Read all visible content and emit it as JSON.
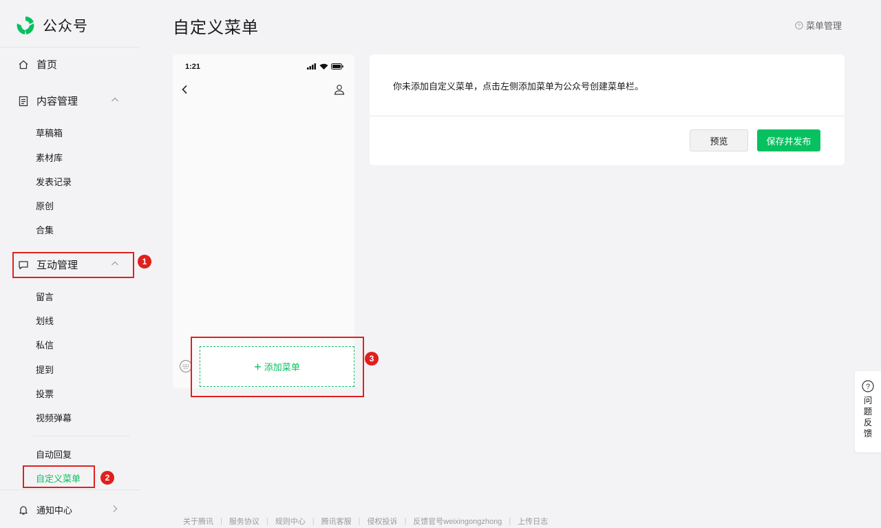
{
  "app": {
    "name": "公众号"
  },
  "sidebar": {
    "home": "首页",
    "content_mgmt": "内容管理",
    "content_items": [
      "草稿箱",
      "素材库",
      "发表记录",
      "原创",
      "合集"
    ],
    "interaction_mgmt": "互动管理",
    "interaction_items": [
      "留言",
      "划线",
      "私信",
      "提到",
      "投票",
      "视频弹幕"
    ],
    "auto_reply": "自动回复",
    "custom_menu": "自定义菜单",
    "notifications": "通知中心"
  },
  "badges": [
    "1",
    "2",
    "3"
  ],
  "page": {
    "title": "自定义菜单",
    "help_link": "菜单管理"
  },
  "phone": {
    "time": "1:21",
    "add_menu": "添加菜单"
  },
  "card": {
    "message": "你未添加自定义菜单，点击左侧添加菜单为公众号创建菜单栏。",
    "preview_button": "预览",
    "publish_button": "保存并发布"
  },
  "feedback": {
    "label": "问题反馈"
  },
  "footer": {
    "links": [
      "关于腾讯",
      "服务协议",
      "规则中心",
      "腾讯客服",
      "侵权投诉",
      "反馈官号weixingongzhong",
      "上传日志"
    ]
  },
  "colors": {
    "accent": "#07c160",
    "annotation": "#e0201e"
  }
}
